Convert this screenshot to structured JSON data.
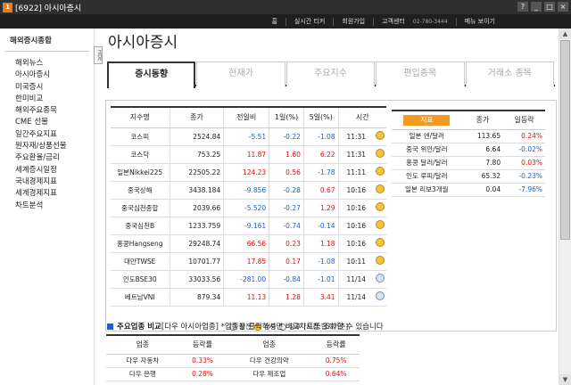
{
  "window": {
    "badge": "1",
    "title": "[6922] 아시아증시"
  },
  "toolbar": {
    "home": "홈",
    "ticker": "실시간 티커",
    "signup": "회원가입",
    "support": "고객센터",
    "phone": "02-780-3444",
    "menu": "메뉴 보이기"
  },
  "sidebar": {
    "heading": "해외증시종합",
    "items": [
      "해외뉴스",
      "아시아증시",
      "미국증시",
      "한미비교",
      "해외주요종목",
      "CME 선물",
      "일간주요지표",
      "원자재/상품선물",
      "주요환율/금리",
      "세계증시일정",
      "국내경제지표",
      "세계경제지표",
      "차트분석"
    ],
    "collapse_label": "HIDE"
  },
  "page_title": "아시아증시",
  "tabs": [
    "증시동향",
    "현재가",
    "주요지수",
    "편입종목",
    "거래소 종목"
  ],
  "index_table": {
    "headers": [
      "지수명",
      "종가",
      "전일비",
      "1일(%)",
      "5일(%)",
      "시간"
    ],
    "rows": [
      {
        "name": "코스피",
        "close": "2524.84",
        "chg": "-5.51",
        "d1": "-0.22",
        "d5": "-1.08",
        "time": "11:31",
        "icon": "sun",
        "dir": [
          "dn",
          "dn",
          "dn"
        ]
      },
      {
        "name": "코스닥",
        "close": "753.25",
        "chg": "11.87",
        "d1": "1.60",
        "d5": "6.22",
        "time": "11:31",
        "icon": "sun",
        "dir": [
          "up",
          "up",
          "up"
        ]
      },
      {
        "name": "일본Nikkei225",
        "close": "22505.22",
        "chg": "124.23",
        "d1": "0.56",
        "d5": "-1.78",
        "time": "11:11",
        "icon": "sun",
        "dir": [
          "up",
          "up",
          "dn"
        ]
      },
      {
        "name": "중국상해",
        "close": "3438.184",
        "chg": "-9.856",
        "d1": "-0.28",
        "d5": "0.67",
        "time": "10:16",
        "icon": "sun",
        "dir": [
          "dn",
          "dn",
          "up"
        ]
      },
      {
        "name": "중국심천종합",
        "close": "2039.66",
        "chg": "-5.520",
        "d1": "-0.27",
        "d5": "1.29",
        "time": "10:16",
        "icon": "sun",
        "dir": [
          "dn",
          "dn",
          "up"
        ]
      },
      {
        "name": "중국심천B",
        "close": "1233.759",
        "chg": "-9.161",
        "d1": "-0.74",
        "d5": "-0.14",
        "time": "10:16",
        "icon": "sun",
        "dir": [
          "dn",
          "dn",
          "dn"
        ]
      },
      {
        "name": "홍콩Hangseng",
        "close": "29248.74",
        "chg": "66.56",
        "d1": "0.23",
        "d5": "1.18",
        "time": "10:16",
        "icon": "sun",
        "dir": [
          "up",
          "up",
          "up"
        ]
      },
      {
        "name": "대만TWSE",
        "close": "10701.77",
        "chg": "17.85",
        "d1": "0.17",
        "d5": "-1.08",
        "time": "10:11",
        "icon": "sun",
        "dir": [
          "up",
          "up",
          "dn"
        ]
      },
      {
        "name": "인도BSE30",
        "close": "33033.56",
        "chg": "-281.00",
        "d1": "-0.84",
        "d5": "-1.01",
        "time": "11/14",
        "icon": "moon",
        "dir": [
          "dn",
          "dn",
          "dn"
        ]
      },
      {
        "name": "베트남VNI",
        "close": "879.34",
        "chg": "11.13",
        "d1": "1.28",
        "d5": "3.41",
        "time": "11/14",
        "icon": "moon",
        "dir": [
          "up",
          "up",
          "up"
        ]
      }
    ],
    "legend": {
      "open": "장전",
      "during": "장중",
      "after": "장후",
      "note": "[시간:현지기준]"
    }
  },
  "fx_table": {
    "headers": [
      "지표",
      "종가",
      "일등락"
    ],
    "rows": [
      {
        "name": "일본 엔/달러",
        "close": "113.65",
        "chg": "0.24%",
        "dir": "up"
      },
      {
        "name": "중국 위안/달러",
        "close": "6.64",
        "chg": "-0.02%",
        "dir": "dn"
      },
      {
        "name": "홍콩 달러/달러",
        "close": "7.80",
        "chg": "0.03%",
        "dir": "up"
      },
      {
        "name": "인도 루피/달러",
        "close": "65.32",
        "chg": "-0.23%",
        "dir": "dn"
      },
      {
        "name": "일본 리보3개월",
        "close": "0.04",
        "chg": "-7.96%",
        "dir": "dn"
      }
    ]
  },
  "sector": {
    "title": "주요업종 비교",
    "subtitle": "[다우 아시아업종]",
    "note": "*업종을 클릭하시면 비교차트를 조회할 수 있습니다",
    "headers": [
      "업종",
      "등락률",
      "업종",
      "등락률"
    ],
    "rows": [
      [
        "다우 자동차",
        "0.33%",
        "다우 건강의약",
        "0.75%"
      ],
      [
        "다우 은행",
        "0.28%",
        "다우 제조업",
        "0.64%"
      ]
    ]
  },
  "colors": {
    "up": "#e01010",
    "down": "#1f5fd0",
    "accent": "#f39a22",
    "titlebar": "#2f2f2f"
  }
}
